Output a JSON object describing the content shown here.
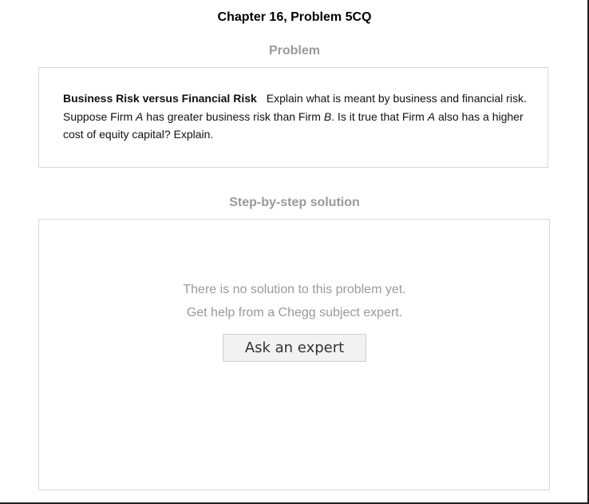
{
  "header": {
    "title": "Chapter 16, Problem 5CQ"
  },
  "problem": {
    "heading": "Problem",
    "lead": "Business Risk versus Financial Risk",
    "text_1": "Explain what is meant by business and financial risk. Suppose Firm ",
    "firm_a": "A",
    "text_2": " has greater business risk than Firm ",
    "firm_b": "B",
    "text_3": ". Is it true that Firm ",
    "firm_a_2": "A",
    "text_4": " also has a higher cost of equity capital? Explain."
  },
  "solution": {
    "heading": "Step-by-step solution",
    "no_solution": "There is no solution to this problem yet.",
    "get_help": "Get help from a Chegg subject expert.",
    "ask_button_label": "Ask an expert"
  }
}
